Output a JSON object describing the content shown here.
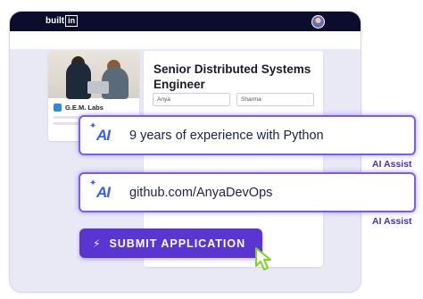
{
  "header": {
    "logo_left": "built",
    "logo_right": "in"
  },
  "company": {
    "name": "G.E.M. Labs"
  },
  "job": {
    "title": "Senior Distributed Systems Engineer",
    "first_name_value": "Anya",
    "last_name_value": "Sharma"
  },
  "assist_rows": [
    {
      "icon_text": "AI",
      "text": "9 years of experience with Python",
      "label": "AI Assist"
    },
    {
      "icon_text": "AI",
      "text": "github.com/AnyaDevOps",
      "label": "AI Assist"
    }
  ],
  "submit": {
    "label": "SUBMIT APPLICATION",
    "icon": "lightning-bolt-icon"
  },
  "colors": {
    "accent_purple": "#5b35d1",
    "ai_blue": "#3562e6",
    "nav_dark": "#0c0d2c"
  }
}
